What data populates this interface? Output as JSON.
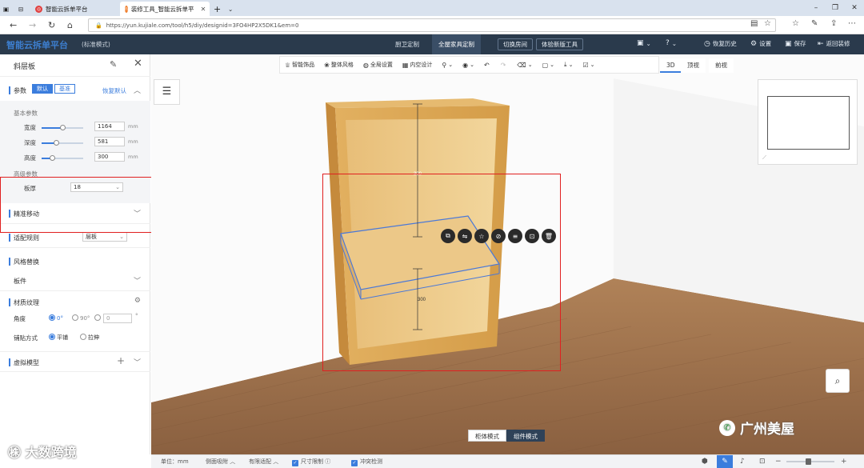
{
  "browser": {
    "tabs": [
      {
        "title": "智能云拆单平台",
        "active": false
      },
      {
        "title": "装修工具_智能云拆单平",
        "active": true
      }
    ],
    "url": "https://yun.kujiale.com/tool/h5/diy/designid=3FO4HP2X5DK1&em=0"
  },
  "app": {
    "brand": "智能云拆单平台",
    "mode": "(标准模式)",
    "center_tabs": [
      {
        "label": "厨卫定制",
        "active": false
      },
      {
        "label": "全屋家具定制",
        "active": true
      }
    ],
    "outline_buttons": [
      "切换房间",
      "体验新版工具"
    ],
    "actions": [
      "恢复历史",
      "设置",
      "保存",
      "返回装修"
    ]
  },
  "panel": {
    "title": "斜层板",
    "params": {
      "label": "参数",
      "seg_on": "默认",
      "seg_off": "基准",
      "reset": "恢复默认",
      "basic": "基本参数",
      "rows": [
        {
          "label": "宽度",
          "value": "1164",
          "unit": "mm",
          "level": 0.5
        },
        {
          "label": "深度",
          "value": "581",
          "unit": "mm",
          "level": 0.35
        },
        {
          "label": "高度",
          "value": "300",
          "unit": "mm",
          "level": 0.25
        }
      ],
      "advanced": "高级参数",
      "thickness_label": "板厚",
      "thickness_value": "18"
    },
    "precise_move": "精准移动",
    "adapt_rule": {
      "label": "适配规则",
      "value": "层板"
    },
    "style_replace": {
      "label": "风格替换",
      "item": "板件"
    },
    "material": {
      "label": "材质纹理",
      "angle_label": "角度",
      "angle_options": [
        "0°",
        "90°"
      ],
      "angle_custom": "0",
      "angle_unit": "°",
      "paste_label": "铺贴方式",
      "paste_options": [
        "平铺",
        "拉伸"
      ]
    },
    "virtual_model": "虚拟模型"
  },
  "toolbar": {
    "items": [
      "智能饰品",
      "整体风格",
      "全局设置",
      "内空设计"
    ],
    "view_tabs": [
      {
        "label": "3D",
        "active": true
      },
      {
        "label": "顶视",
        "active": false
      },
      {
        "label": "前视",
        "active": false
      }
    ]
  },
  "scene": {
    "dim_top": "300",
    "dim_bottom": "300",
    "mode_buttons": [
      {
        "label": "柜体模式",
        "active": false
      },
      {
        "label": "组件模式",
        "active": true
      }
    ]
  },
  "statusbar": {
    "unit": "单位：mm",
    "side_adsorb": "侧面吸附",
    "auto_fit": "有限适配",
    "size_limit": "尺寸限制",
    "conflict": "冲突检测"
  },
  "watermarks": {
    "left": "大数跨境",
    "right": "广州美屋"
  }
}
